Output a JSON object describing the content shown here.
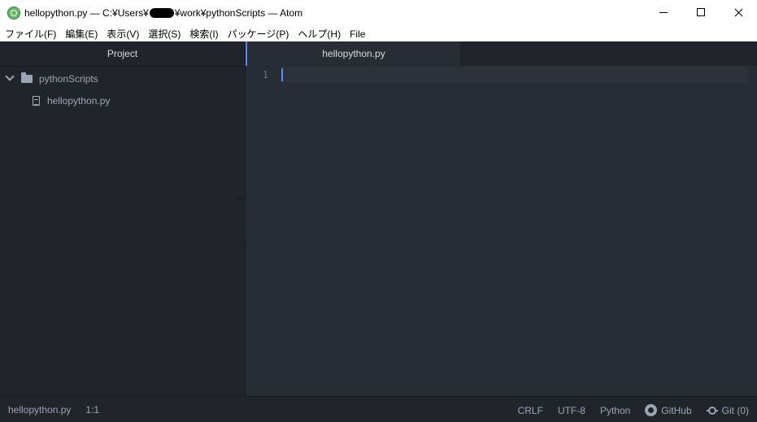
{
  "window": {
    "title_before_mask": "hellopython.py — C:¥Users¥",
    "title_after_mask": "¥work¥pythonScripts — Atom"
  },
  "menu": [
    "ファイル(F)",
    "編集(E)",
    "表示(V)",
    "選択(S)",
    "検索(I)",
    "パッケージ(P)",
    "ヘルプ(H)",
    "File"
  ],
  "tree": {
    "header": "Project",
    "folder": "pythonScripts",
    "file": "hellopython.py"
  },
  "tabs": [
    {
      "label": "hellopython.py"
    }
  ],
  "editor": {
    "line_numbers": [
      "1"
    ]
  },
  "status": {
    "file": "hellopython.py",
    "position": "1:1",
    "line_ending": "CRLF",
    "encoding": "UTF-8",
    "grammar": "Python",
    "github": "GitHub",
    "git": "Git (0)"
  },
  "colors": {
    "accent": "#568af2",
    "background": "#282c34",
    "panel": "#21252b"
  }
}
